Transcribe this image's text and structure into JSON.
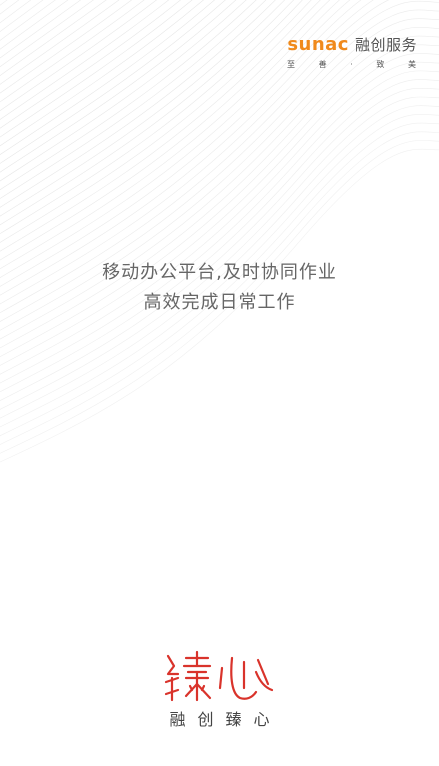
{
  "brand": {
    "latin_name": "sunac",
    "cn_name": "融创服务",
    "slogan": [
      "至",
      "善",
      "·",
      "致",
      "美"
    ]
  },
  "tagline": {
    "line1": "移动办公平台,及时协同作业",
    "line2": "高效完成日常工作"
  },
  "bottom_logo": {
    "logo_text": "臻心",
    "caption": [
      "融",
      "创",
      "臻",
      "心"
    ]
  },
  "colors": {
    "brand_orange": "#f08a1c",
    "brand_gray": "#555555",
    "tagline_text": "#666666",
    "logo_red": "#d9332b",
    "caption_text": "#444444",
    "background_lines": "#e6e6e6"
  },
  "icons": {
    "background": "wave-lines-pattern",
    "bottom_logo": "zhenxin-calligraphy-logo"
  }
}
